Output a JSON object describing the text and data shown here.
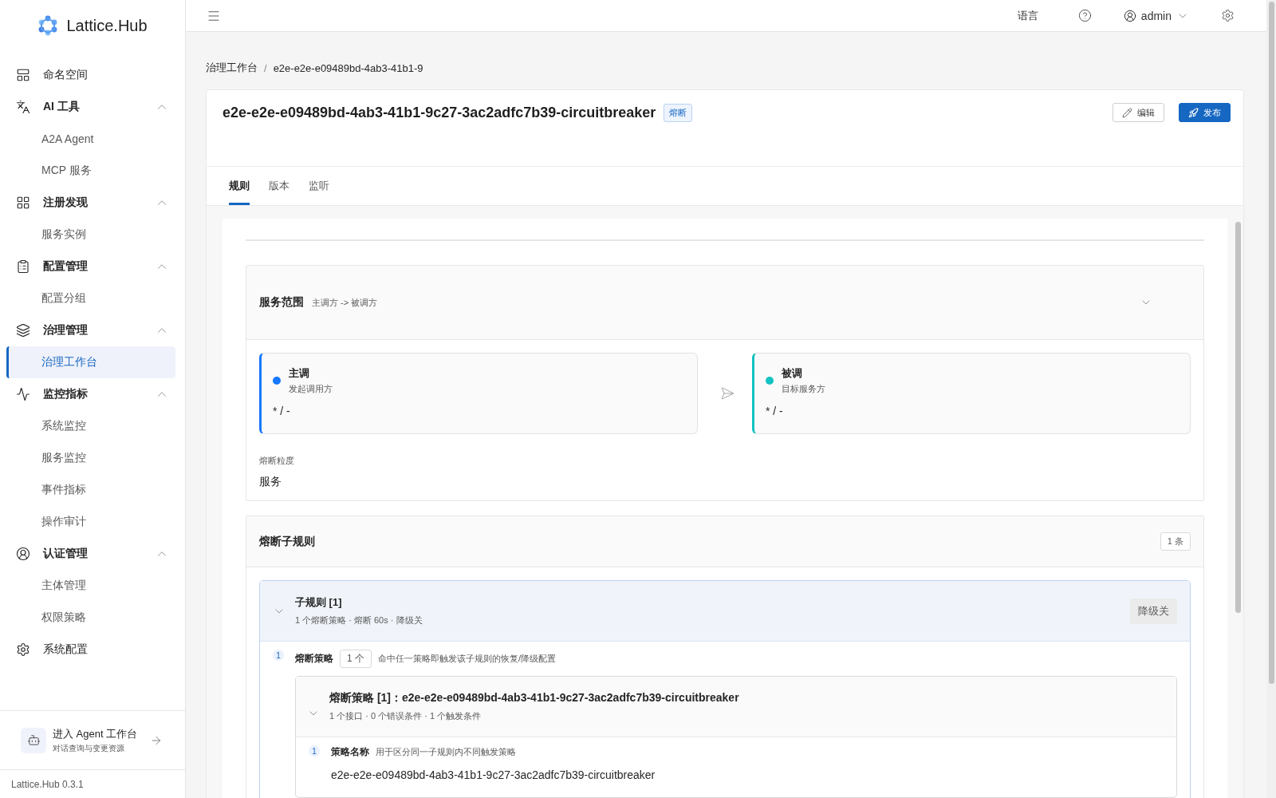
{
  "brand": {
    "name": "Lattice.Hub"
  },
  "sidebar": {
    "items": [
      {
        "label": "命名空间"
      },
      {
        "label": "AI 工具",
        "expanded": true,
        "children": [
          {
            "label": "A2A Agent",
            "selected": false
          },
          {
            "label": "MCP 服务",
            "selected": false
          }
        ]
      },
      {
        "label": "注册发现",
        "expanded": true,
        "children": [
          {
            "label": "服务实例",
            "selected": false
          }
        ]
      },
      {
        "label": "配置管理",
        "expanded": true,
        "children": [
          {
            "label": "配置分组",
            "selected": false
          }
        ]
      },
      {
        "label": "治理管理",
        "expanded": true,
        "children": [
          {
            "label": "治理工作台",
            "selected": true
          }
        ]
      },
      {
        "label": "监控指标",
        "expanded": true,
        "children": [
          {
            "label": "系统监控",
            "selected": false
          },
          {
            "label": "服务监控",
            "selected": false
          },
          {
            "label": "事件指标",
            "selected": false
          },
          {
            "label": "操作审计",
            "selected": false
          }
        ]
      },
      {
        "label": "认证管理",
        "expanded": true,
        "children": [
          {
            "label": "主体管理",
            "selected": false
          },
          {
            "label": "权限策略",
            "selected": false
          }
        ]
      },
      {
        "label": "系统配置"
      }
    ]
  },
  "agent_entry": {
    "title": "进入 Agent 工作台",
    "subtitle": "对话查询与变更资源"
  },
  "version": "Lattice.Hub 0.3.1",
  "header": {
    "language": "语言",
    "user": "admin"
  },
  "breadcrumb": {
    "items": [
      "治理工作台",
      "e2e-e2e-e09489bd-4ab3-41b1-9"
    ],
    "separator": "/"
  },
  "rule": {
    "title": "e2e-e2e-e09489bd-4ab3-41b1-9c27-3ac2adfc7b39-circuitbreaker",
    "tag": "熔断",
    "actions": [
      {
        "label": "编辑",
        "kind": "default"
      },
      {
        "label": "发布",
        "kind": "primary"
      }
    ]
  },
  "tabs": [
    {
      "label": "规则",
      "selected": true
    },
    {
      "label": "版本",
      "selected": false
    },
    {
      "label": "监听",
      "selected": false
    }
  ],
  "service_scope": {
    "title": "服务范围",
    "subtitle": "主调方 -> 被调方",
    "expanded": true,
    "parties": [
      {
        "title": "主调",
        "subtitle": "发起调用方",
        "value": "* / -",
        "color": "#1677ff"
      },
      {
        "title": "被调",
        "subtitle": "目标服务方",
        "value": "* / -",
        "color": "#13c2c2"
      }
    ],
    "granularity": {
      "label": "熔断粒度",
      "value": "服务"
    }
  },
  "sub_rules": {
    "title": "熔断子规则",
    "count": "1 条",
    "items": [
      {
        "title": "子规则 [1]",
        "summary": "1 个熔断策略 · 熔断 60s · 降级关",
        "expanded": true,
        "tag": "降级关",
        "steps": [
          {
            "number": "1",
            "label": "熔断策略",
            "count": "1 个",
            "hint": "命中任一策略即触发该子规则的恢复/降级配置",
            "policies": [
              {
                "title": "熔断策略 [1]：e2e-e2e-e09489bd-4ab3-41b1-9c27-3ac2adfc7b39-circuitbreaker",
                "summary": "1 个接口 · 0 个错误条件 · 1 个触发条件",
                "expanded": true,
                "fields": [
                  {
                    "number": "1",
                    "label": "策略名称",
                    "hint": "用于区分同一子规则内不同触发策略",
                    "value": "e2e-e2e-e09489bd-4ab3-41b1-9c27-3ac2adfc7b39-circuitbreaker"
                  }
                ]
              }
            ]
          }
        ]
      }
    ]
  }
}
